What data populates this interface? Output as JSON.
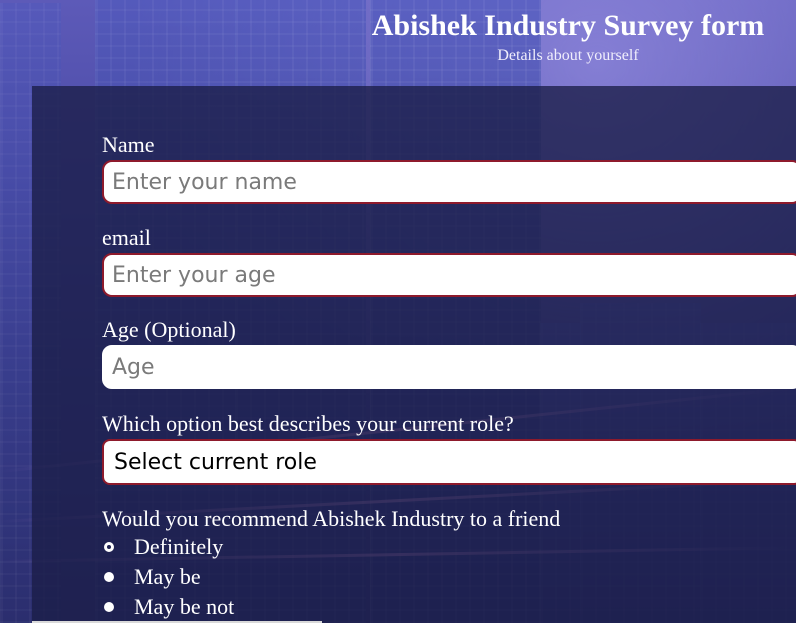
{
  "header": {
    "title": "Abishek Industry Survey form",
    "subtitle": "Details about yourself"
  },
  "form": {
    "name": {
      "label": "Name",
      "placeholder": "Enter your name"
    },
    "email": {
      "label": "email",
      "placeholder": "Enter your age"
    },
    "age": {
      "label": "Age (Optional)",
      "placeholder": "Age"
    },
    "role": {
      "label": "Which option best describes your current role?",
      "selected": "Select current role"
    },
    "recommend": {
      "label": "Would you recommend Abishek Industry to a friend",
      "options": [
        "Definitely",
        "May be",
        "May be not"
      ]
    }
  },
  "colors": {
    "background": "#4a4aa6",
    "panel": "#1b1e48",
    "input_border": "#8e1a2c"
  }
}
